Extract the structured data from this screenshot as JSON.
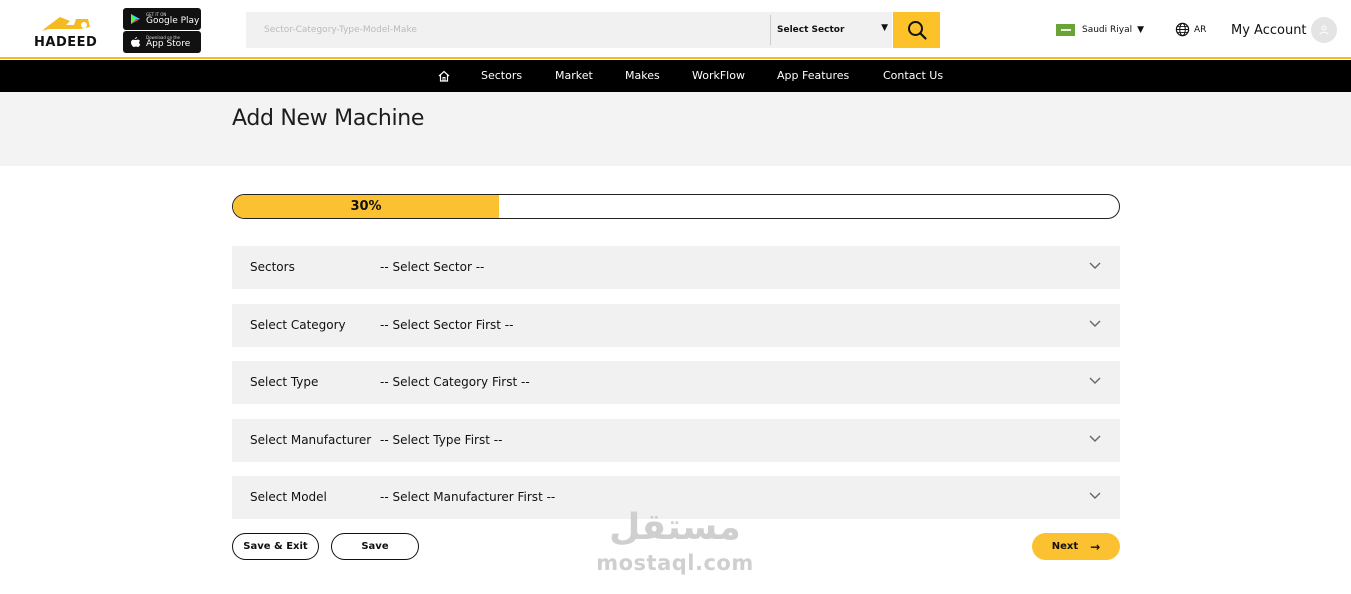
{
  "header": {
    "logo_text": "HADEED",
    "google_play": {
      "small": "GET IT ON",
      "big": "Google Play"
    },
    "app_store": {
      "small": "Download on the",
      "big": "App Store"
    },
    "search_placeholder": "Sector-Category-Type-Model-Make",
    "sector_select": "Select Sector",
    "currency": "Saudi Riyal",
    "language": "AR",
    "account": "My Account"
  },
  "nav": {
    "items": [
      "Sectors",
      "Market",
      "Makes",
      "WorkFlow",
      "App Features",
      "Contact Us"
    ]
  },
  "page": {
    "title": "Add New Machine"
  },
  "progress": {
    "label": "30%",
    "value": 0.3
  },
  "form": {
    "rows": [
      {
        "label": "Sectors",
        "value": "-- Select Sector --"
      },
      {
        "label": "Select Category",
        "value": "-- Select Sector First --"
      },
      {
        "label": "Select Type",
        "value": "-- Select Category First --"
      },
      {
        "label": "Select Manufacturer",
        "value": "-- Select Type First --"
      },
      {
        "label": "Select Model",
        "value": "-- Select Manufacturer First --"
      }
    ]
  },
  "actions": {
    "save_exit": "Save & Exit",
    "save": "Save",
    "next": "Next",
    "next_arrow": "→"
  },
  "watermark": {
    "arabic": "مستقل",
    "latin": "mostaql.com"
  },
  "colors": {
    "accent": "#fcc131",
    "nav_bg": "#000000",
    "row_bg": "#f1f1f1"
  }
}
